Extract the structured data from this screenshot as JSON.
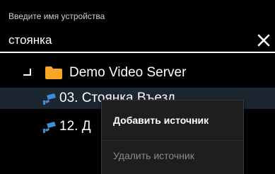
{
  "search": {
    "label": "Введите имя устройства",
    "value": "стоянка"
  },
  "tree": {
    "server": {
      "label": "Demo Video Server",
      "icon": "folder-icon",
      "expander_icon": "expanded-icon"
    },
    "cameras": [
      {
        "label": "03. Стоянка Въезд",
        "icon": "camera-icon",
        "selected": true
      },
      {
        "label": "12. Д",
        "icon": "camera-icon",
        "selected": false
      }
    ]
  },
  "context_menu": {
    "items": [
      {
        "label": "Добавить источник",
        "enabled": true
      },
      {
        "label": "Удалить источник",
        "enabled": false
      }
    ]
  },
  "colors": {
    "background": "#000000",
    "folder": "#f5a623",
    "camera": "#3d8fd9",
    "selected_row": "#1c2631",
    "menu_bg": "#1e1e1e",
    "disabled_text": "#8a8a8a"
  }
}
